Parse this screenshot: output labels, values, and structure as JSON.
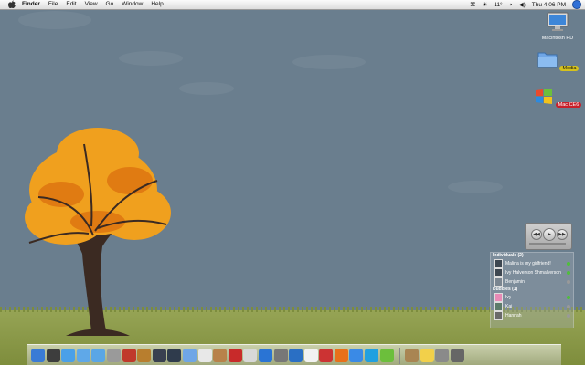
{
  "menubar": {
    "menus": [
      "Finder",
      "File",
      "Edit",
      "View",
      "Go",
      "Window",
      "Help"
    ],
    "temperature": "11°",
    "clock": "Thu 4:06 PM"
  },
  "desktop_icons": [
    {
      "label": "Macintosh HD",
      "icon": "hard-drive-icon"
    },
    {
      "label": "Media",
      "icon": "folder-icon"
    },
    {
      "label": "Mac CE6",
      "icon": "windows-logo-icon"
    }
  ],
  "chat": {
    "individuals": {
      "header": "Individuals (2)",
      "contacts": [
        {
          "name": "Malina is my girlfriend!",
          "status_color": "#4fbf3a"
        },
        {
          "name": "Ivy Halverson Shmalverson",
          "status_color": "#4fbf3a"
        },
        {
          "name": "Benjamin",
          "status_color": "#999999"
        }
      ]
    },
    "buddies": {
      "header": "Buddies (1)",
      "contacts": [
        {
          "name": "Ivy",
          "status_color": "#4fbf3a"
        },
        {
          "name": "Kai",
          "status_color": "#999999"
        },
        {
          "name": "Hannah",
          "status_color": "#999999"
        }
      ]
    }
  },
  "dock": {
    "icons": [
      "finder",
      "dashboard",
      "itunes",
      "mail",
      "safari",
      "sync",
      "photo-booth",
      "garageband",
      "imovie",
      "final-cut",
      "iphoto",
      "ical",
      "address-book",
      "acrobat",
      "quicktime",
      "itunes-store",
      "camera",
      "globe",
      "textedit",
      "flash",
      "firefox",
      "ichat",
      "skype",
      "android",
      "sep",
      "documents",
      "stickies",
      "system-preferences",
      "trash"
    ]
  }
}
